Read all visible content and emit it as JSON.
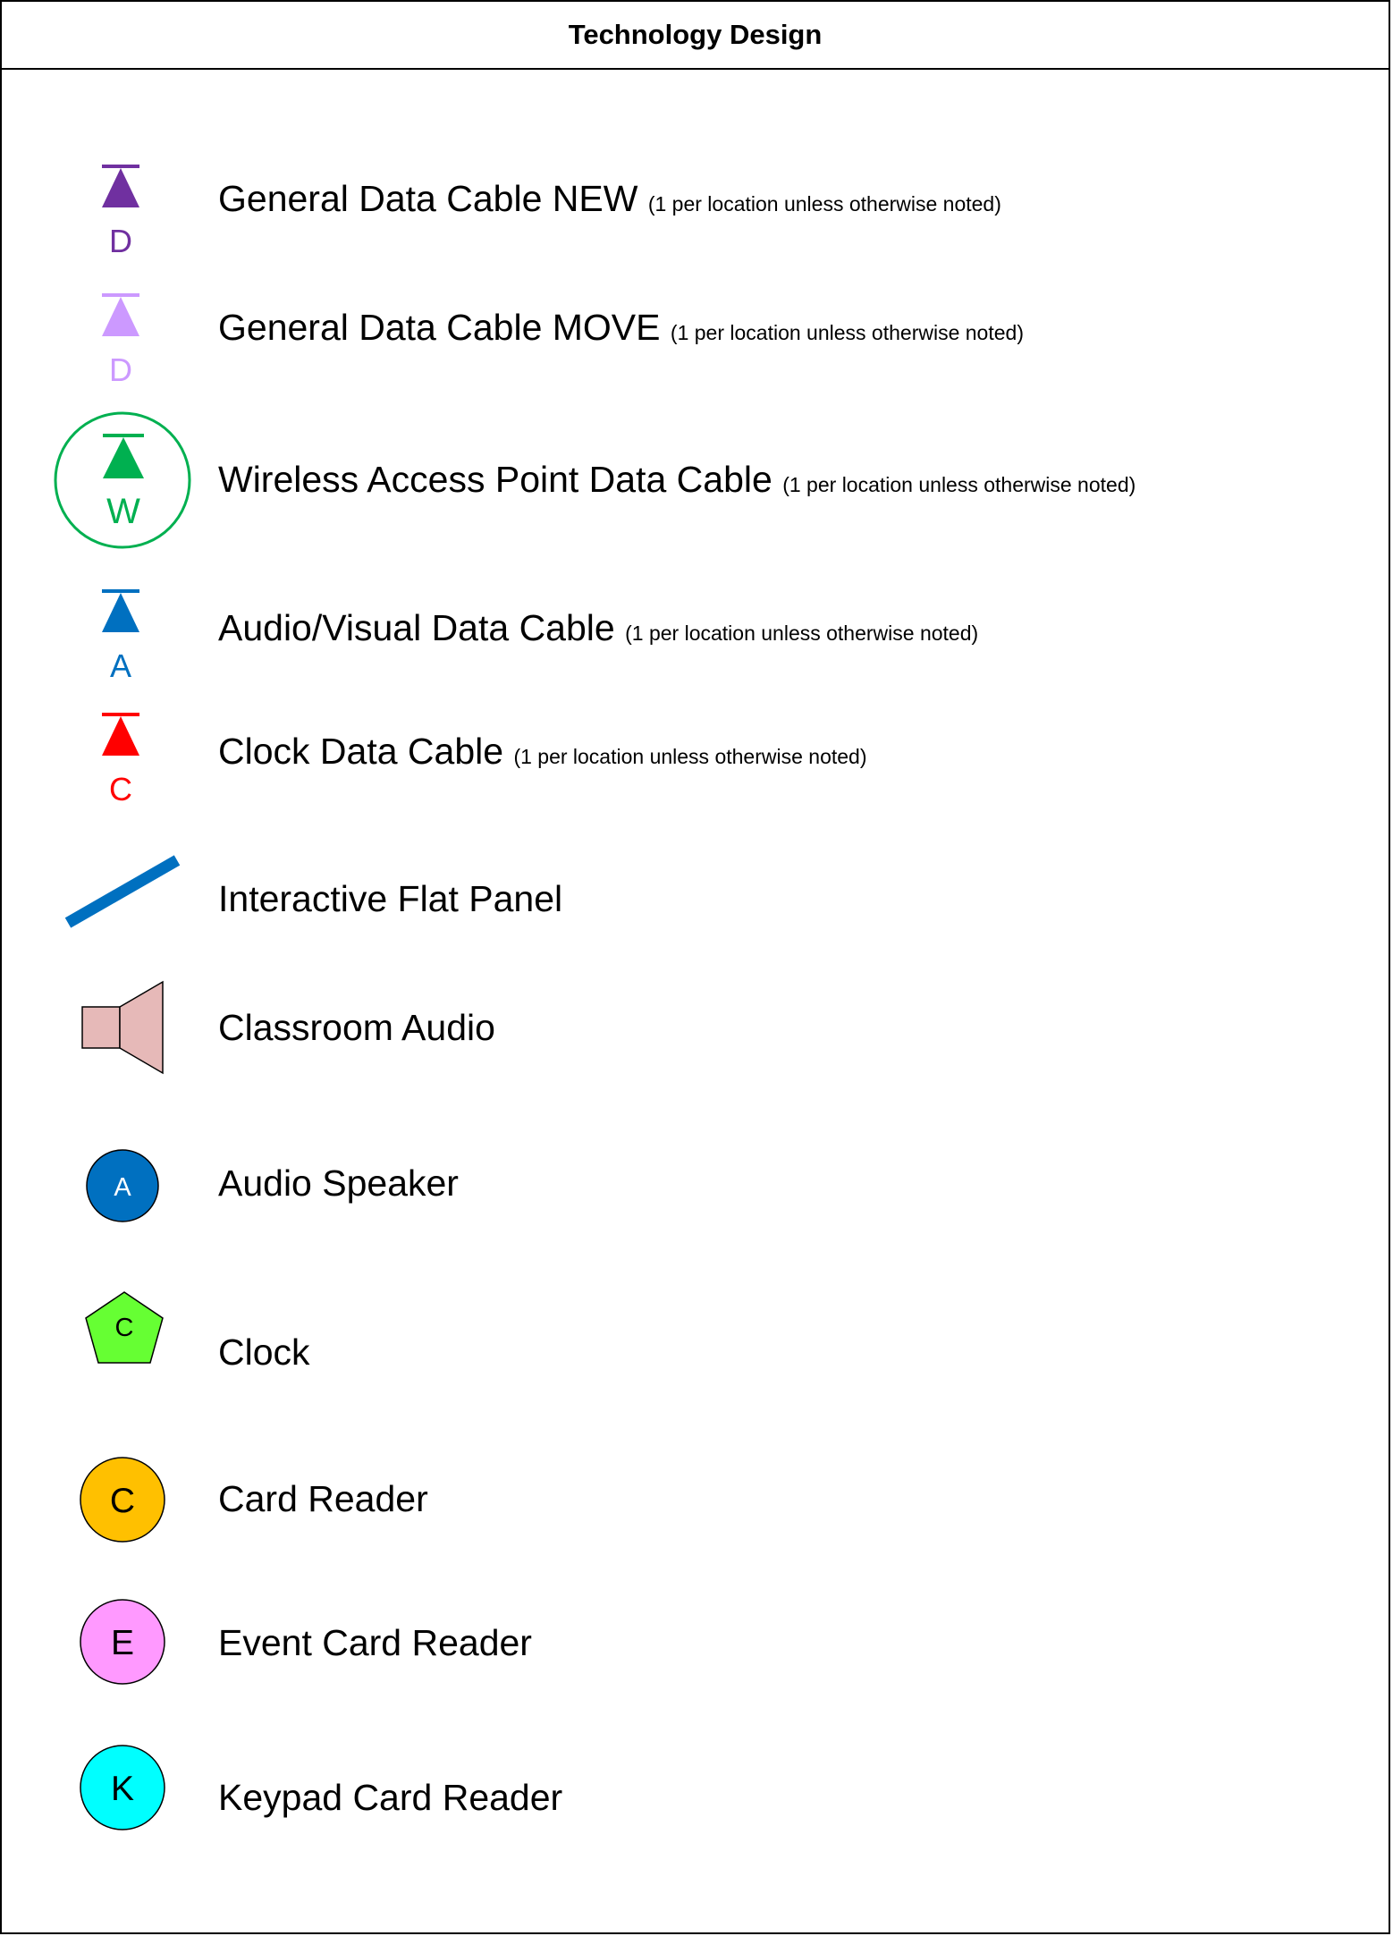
{
  "title": "Technology Design",
  "colors": {
    "data_new": "#7030A0",
    "data_move": "#CC99FF",
    "wireless": "#00B050",
    "av": "#0070C0",
    "clock_cable": "#FF0000",
    "flat_panel": "#0070C0",
    "classroom_audio": "#E6B9B8",
    "audio_speaker": "#0070C0",
    "clock": "#66FF33",
    "card_reader": "#FFC000",
    "event_card_reader": "#FF99FF",
    "keypad_card_reader": "#00FFFF"
  },
  "items": [
    {
      "icon": "data-cable-new-icon",
      "letter": "D",
      "label": "General Data Cable NEW",
      "note": "(1 per location unless otherwise noted)"
    },
    {
      "icon": "data-cable-move-icon",
      "letter": "D",
      "label": "General Data Cable MOVE",
      "note": "(1 per location unless otherwise noted)"
    },
    {
      "icon": "wireless-access-point-icon",
      "letter": "W",
      "label": "Wireless Access Point Data Cable",
      "note": "(1 per location unless otherwise noted)"
    },
    {
      "icon": "av-data-cable-icon",
      "letter": "A",
      "label": "Audio/Visual Data Cable",
      "note": "(1 per location unless otherwise noted)"
    },
    {
      "icon": "clock-data-cable-icon",
      "letter": "C",
      "label": "Clock Data Cable",
      "note": "(1 per location unless otherwise noted)"
    },
    {
      "icon": "flat-panel-icon",
      "label": "Interactive Flat Panel"
    },
    {
      "icon": "speaker-horn-icon",
      "label": "Classroom Audio"
    },
    {
      "icon": "audio-speaker-icon",
      "letter": "A",
      "label": "Audio Speaker"
    },
    {
      "icon": "clock-pentagon-icon",
      "letter": "C",
      "label": "Clock"
    },
    {
      "icon": "card-reader-icon",
      "letter": "C",
      "label": "Card Reader"
    },
    {
      "icon": "event-card-reader-icon",
      "letter": "E",
      "label": "Event Card Reader"
    },
    {
      "icon": "keypad-card-reader-icon",
      "letter": "K",
      "label": "Keypad Card Reader"
    }
  ]
}
